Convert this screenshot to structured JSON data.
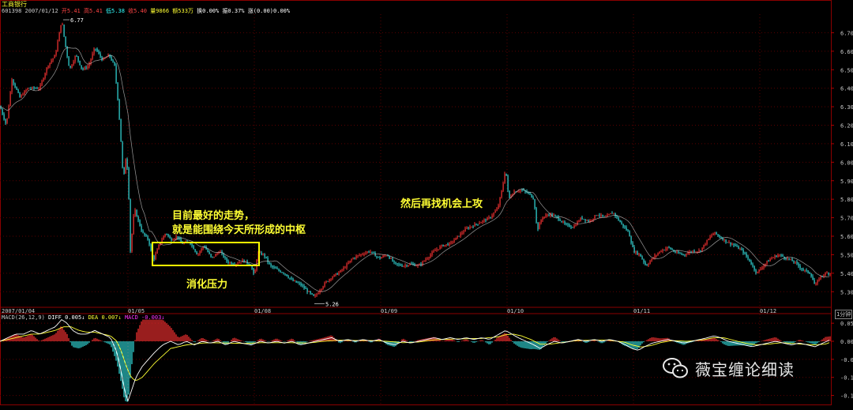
{
  "stock": {
    "name": "工商银行",
    "code": "601398",
    "date": "2007/01/12"
  },
  "header_line": [
    {
      "text": "开5.41",
      "color": "#ff4444"
    },
    {
      "text": "高5.41",
      "color": "#ff4444"
    },
    {
      "text": "低5.38",
      "color": "#33ffff"
    },
    {
      "text": "收5.40",
      "color": "#ff4444"
    },
    {
      "text": "量9866",
      "color": "#ffff33"
    },
    {
      "text": "额533万",
      "color": "#ffff33"
    },
    {
      "text": "换0.00%",
      "color": "#ffffff"
    },
    {
      "text": "振0.37%",
      "color": "#ffffff"
    },
    {
      "text": "涨(0.00)0.00%",
      "color": "#ffffff"
    }
  ],
  "macd_line": [
    {
      "text": "MACD(26,12,9)",
      "color": "#cccccc"
    },
    {
      "text": "DIFF 0.005↓",
      "color": "#ffffff"
    },
    {
      "text": "DEA 0.007↓",
      "color": "#ffff33"
    },
    {
      "text": "MACD -0.003↓",
      "color": "#ff33ff"
    }
  ],
  "annotations": {
    "line1": "目前最好的走势，",
    "line2": "就是能围绕今天所形成的中枢",
    "pressure": "消化压力",
    "next": "然后再找机会上攻"
  },
  "watermark": "薇宝缠论细读",
  "period": "1分钟",
  "price_marks": {
    "high": "6.77",
    "low": "5.26"
  },
  "chart_data": [
    {
      "type": "candlestick",
      "title": "工商银行",
      "y_ticks": [
        "6.70",
        "6.60",
        "6.50",
        "6.40",
        "6.30",
        "6.20",
        "6.10",
        "6.00",
        "5.90",
        "5.80",
        "5.70",
        "5.60",
        "5.50",
        "5.40",
        "5.30"
      ],
      "ylim": [
        5.22,
        6.8
      ],
      "x_ticks": [
        "2007/01/04",
        "01/05",
        "01/08",
        "01/09",
        "01/10",
        "01/11",
        "01/12"
      ],
      "grid": true,
      "path": [
        [
          0,
          6.3
        ],
        [
          8,
          6.2
        ],
        [
          15,
          6.45
        ],
        [
          25,
          6.35
        ],
        [
          35,
          6.4
        ],
        [
          50,
          6.4
        ],
        [
          60,
          6.52
        ],
        [
          70,
          6.58
        ],
        [
          78,
          6.77
        ],
        [
          82,
          6.65
        ],
        [
          88,
          6.5
        ],
        [
          96,
          6.58
        ],
        [
          104,
          6.5
        ],
        [
          112,
          6.52
        ],
        [
          120,
          6.62
        ],
        [
          130,
          6.55
        ],
        [
          138,
          6.58
        ],
        [
          145,
          6.52
        ],
        [
          150,
          6.3
        ],
        [
          154,
          6.05
        ],
        [
          156,
          5.89
        ],
        [
          159,
          6.02
        ],
        [
          162,
          5.95
        ],
        [
          165,
          5.52
        ],
        [
          170,
          5.75
        ],
        [
          180,
          5.62
        ],
        [
          188,
          5.58
        ],
        [
          192,
          5.5
        ],
        [
          195,
          5.48
        ],
        [
          202,
          5.56
        ],
        [
          210,
          5.62
        ],
        [
          216,
          5.58
        ],
        [
          224,
          5.6
        ],
        [
          230,
          5.56
        ],
        [
          240,
          5.57
        ],
        [
          250,
          5.5
        ],
        [
          258,
          5.55
        ],
        [
          268,
          5.48
        ],
        [
          278,
          5.52
        ],
        [
          288,
          5.46
        ],
        [
          298,
          5.45
        ],
        [
          308,
          5.47
        ],
        [
          318,
          5.44
        ],
        [
          322,
          5.38
        ],
        [
          326,
          5.51
        ],
        [
          334,
          5.5
        ],
        [
          342,
          5.44
        ],
        [
          350,
          5.42
        ],
        [
          360,
          5.4
        ],
        [
          370,
          5.36
        ],
        [
          380,
          5.34
        ],
        [
          390,
          5.3
        ],
        [
          398,
          5.27
        ],
        [
          405,
          5.31
        ],
        [
          412,
          5.35
        ],
        [
          420,
          5.38
        ],
        [
          428,
          5.4
        ],
        [
          436,
          5.43
        ],
        [
          446,
          5.48
        ],
        [
          456,
          5.5
        ],
        [
          468,
          5.52
        ],
        [
          480,
          5.48
        ],
        [
          490,
          5.5
        ],
        [
          500,
          5.45
        ],
        [
          510,
          5.44
        ],
        [
          520,
          5.45
        ],
        [
          530,
          5.44
        ],
        [
          540,
          5.48
        ],
        [
          550,
          5.52
        ],
        [
          560,
          5.55
        ],
        [
          570,
          5.56
        ],
        [
          580,
          5.6
        ],
        [
          590,
          5.64
        ],
        [
          600,
          5.66
        ],
        [
          610,
          5.68
        ],
        [
          620,
          5.7
        ],
        [
          630,
          5.75
        ],
        [
          636,
          5.86
        ],
        [
          640,
          5.97
        ],
        [
          644,
          5.8
        ],
        [
          650,
          5.84
        ],
        [
          660,
          5.85
        ],
        [
          670,
          5.83
        ],
        [
          676,
          5.8
        ],
        [
          680,
          5.63
        ],
        [
          686,
          5.7
        ],
        [
          696,
          5.72
        ],
        [
          706,
          5.7
        ],
        [
          716,
          5.66
        ],
        [
          726,
          5.65
        ],
        [
          736,
          5.7
        ],
        [
          746,
          5.68
        ],
        [
          756,
          5.72
        ],
        [
          766,
          5.7
        ],
        [
          776,
          5.73
        ],
        [
          786,
          5.67
        ],
        [
          796,
          5.62
        ],
        [
          802,
          5.52
        ],
        [
          810,
          5.5
        ],
        [
          818,
          5.44
        ],
        [
          826,
          5.48
        ],
        [
          836,
          5.52
        ],
        [
          846,
          5.54
        ],
        [
          856,
          5.51
        ],
        [
          866,
          5.5
        ],
        [
          876,
          5.52
        ],
        [
          886,
          5.52
        ],
        [
          896,
          5.58
        ],
        [
          904,
          5.62
        ],
        [
          910,
          5.6
        ],
        [
          920,
          5.57
        ],
        [
          930,
          5.55
        ],
        [
          940,
          5.52
        ],
        [
          950,
          5.46
        ],
        [
          958,
          5.4
        ],
        [
          966,
          5.44
        ],
        [
          976,
          5.48
        ],
        [
          986,
          5.5
        ],
        [
          996,
          5.48
        ],
        [
          1006,
          5.46
        ],
        [
          1016,
          5.42
        ],
        [
          1026,
          5.4
        ],
        [
          1032,
          5.33
        ],
        [
          1038,
          5.38
        ],
        [
          1046,
          5.4
        ],
        [
          1052,
          5.4
        ]
      ]
    },
    {
      "type": "bar",
      "title": "MACD(26,12,9)",
      "y_ticks": [
        "0.05",
        "0.00",
        "-0.05",
        "-0.10",
        "-0.15"
      ],
      "ylim": [
        -0.175,
        0.07
      ],
      "series": [
        {
          "name": "DIFF",
          "color": "#ffffff"
        },
        {
          "name": "DEA",
          "color": "#ffff33"
        },
        {
          "name": "MACD",
          "color": "#ff33ff"
        }
      ],
      "diff_path": [
        [
          0,
          0.0
        ],
        [
          10,
          0.01
        ],
        [
          20,
          0.02
        ],
        [
          30,
          0.02
        ],
        [
          40,
          0.03
        ],
        [
          50,
          0.02
        ],
        [
          60,
          0.03
        ],
        [
          70,
          0.04
        ],
        [
          78,
          0.06
        ],
        [
          85,
          0.05
        ],
        [
          92,
          0.03
        ],
        [
          100,
          0.02
        ],
        [
          110,
          0.02
        ],
        [
          120,
          0.03
        ],
        [
          130,
          0.02
        ],
        [
          140,
          0.01
        ],
        [
          148,
          -0.03
        ],
        [
          154,
          -0.09
        ],
        [
          158,
          -0.14
        ],
        [
          162,
          -0.165
        ],
        [
          166,
          -0.14
        ],
        [
          172,
          -0.1
        ],
        [
          180,
          -0.07
        ],
        [
          188,
          -0.05
        ],
        [
          196,
          -0.03
        ],
        [
          206,
          -0.01
        ],
        [
          216,
          0.0
        ],
        [
          226,
          -0.01
        ],
        [
          236,
          0.0
        ],
        [
          246,
          -0.01
        ],
        [
          256,
          0.0
        ],
        [
          266,
          -0.005
        ],
        [
          276,
          0.0
        ],
        [
          286,
          -0.01
        ],
        [
          296,
          0.0
        ],
        [
          306,
          -0.005
        ],
        [
          318,
          -0.01
        ],
        [
          330,
          0.0
        ],
        [
          340,
          -0.005
        ],
        [
          350,
          0.0
        ],
        [
          360,
          -0.005
        ],
        [
          370,
          0.0
        ],
        [
          380,
          -0.01
        ],
        [
          390,
          -0.005
        ],
        [
          400,
          0.0
        ],
        [
          410,
          0.005
        ],
        [
          420,
          0.01
        ],
        [
          430,
          0.0
        ],
        [
          440,
          0.005
        ],
        [
          450,
          0.0
        ],
        [
          460,
          0.005
        ],
        [
          470,
          0.0
        ],
        [
          480,
          0.005
        ],
        [
          490,
          -0.005
        ],
        [
          500,
          -0.01
        ],
        [
          510,
          0.0
        ],
        [
          520,
          -0.005
        ],
        [
          530,
          0.0
        ],
        [
          540,
          0.005
        ],
        [
          550,
          0.01
        ],
        [
          560,
          0.005
        ],
        [
          570,
          0.01
        ],
        [
          580,
          0.005
        ],
        [
          590,
          0.01
        ],
        [
          600,
          0.005
        ],
        [
          610,
          0.01
        ],
        [
          620,
          0.005
        ],
        [
          632,
          0.02
        ],
        [
          640,
          0.03
        ],
        [
          648,
          0.02
        ],
        [
          656,
          0.01
        ],
        [
          666,
          0.0
        ],
        [
          676,
          -0.01
        ],
        [
          684,
          -0.02
        ],
        [
          692,
          -0.01
        ],
        [
          702,
          0.0
        ],
        [
          712,
          -0.005
        ],
        [
          722,
          0.0
        ],
        [
          732,
          0.005
        ],
        [
          742,
          0.0
        ],
        [
          752,
          0.005
        ],
        [
          762,
          0.0
        ],
        [
          772,
          0.005
        ],
        [
          782,
          0.0
        ],
        [
          792,
          -0.01
        ],
        [
          800,
          -0.02
        ],
        [
          808,
          -0.025
        ],
        [
          816,
          -0.015
        ],
        [
          826,
          -0.005
        ],
        [
          836,
          0.0
        ],
        [
          846,
          0.005
        ],
        [
          856,
          0.0
        ],
        [
          866,
          -0.005
        ],
        [
          876,
          0.0
        ],
        [
          886,
          0.005
        ],
        [
          896,
          0.01
        ],
        [
          904,
          0.015
        ],
        [
          912,
          0.01
        ],
        [
          922,
          0.0
        ],
        [
          932,
          -0.005
        ],
        [
          942,
          -0.01
        ],
        [
          952,
          -0.015
        ],
        [
          962,
          -0.01
        ],
        [
          972,
          -0.005
        ],
        [
          982,
          0.0
        ],
        [
          992,
          -0.005
        ],
        [
          1002,
          -0.01
        ],
        [
          1012,
          -0.005
        ],
        [
          1022,
          -0.01
        ],
        [
          1032,
          -0.015
        ],
        [
          1042,
          -0.005
        ],
        [
          1052,
          0.005
        ]
      ],
      "dea_path": [
        [
          0,
          0.0
        ],
        [
          10,
          0.005
        ],
        [
          20,
          0.01
        ],
        [
          30,
          0.015
        ],
        [
          40,
          0.02
        ],
        [
          50,
          0.02
        ],
        [
          60,
          0.025
        ],
        [
          70,
          0.03
        ],
        [
          80,
          0.04
        ],
        [
          90,
          0.04
        ],
        [
          100,
          0.03
        ],
        [
          110,
          0.025
        ],
        [
          120,
          0.025
        ],
        [
          130,
          0.02
        ],
        [
          140,
          0.015
        ],
        [
          148,
          0.0
        ],
        [
          154,
          -0.03
        ],
        [
          160,
          -0.07
        ],
        [
          166,
          -0.1
        ],
        [
          172,
          -0.11
        ],
        [
          180,
          -0.1
        ],
        [
          188,
          -0.08
        ],
        [
          196,
          -0.06
        ],
        [
          206,
          -0.04
        ],
        [
          216,
          -0.02
        ],
        [
          226,
          -0.015
        ],
        [
          236,
          -0.01
        ],
        [
          246,
          -0.008
        ],
        [
          256,
          -0.005
        ],
        [
          270,
          -0.004
        ],
        [
          290,
          -0.005
        ],
        [
          310,
          -0.006
        ],
        [
          330,
          -0.004
        ],
        [
          350,
          -0.004
        ],
        [
          370,
          -0.004
        ],
        [
          390,
          -0.005
        ],
        [
          410,
          0.0
        ],
        [
          430,
          0.003
        ],
        [
          450,
          0.002
        ],
        [
          470,
          0.002
        ],
        [
          490,
          0.0
        ],
        [
          510,
          -0.004
        ],
        [
          530,
          -0.002
        ],
        [
          550,
          0.004
        ],
        [
          570,
          0.006
        ],
        [
          590,
          0.007
        ],
        [
          610,
          0.008
        ],
        [
          630,
          0.012
        ],
        [
          640,
          0.018
        ],
        [
          650,
          0.02
        ],
        [
          660,
          0.015
        ],
        [
          672,
          0.005
        ],
        [
          684,
          -0.008
        ],
        [
          696,
          -0.008
        ],
        [
          710,
          -0.004
        ],
        [
          730,
          0.002
        ],
        [
          750,
          0.003
        ],
        [
          770,
          0.003
        ],
        [
          790,
          -0.002
        ],
        [
          800,
          -0.01
        ],
        [
          812,
          -0.016
        ],
        [
          824,
          -0.012
        ],
        [
          836,
          -0.004
        ],
        [
          850,
          0.002
        ],
        [
          870,
          0.0
        ],
        [
          890,
          0.004
        ],
        [
          904,
          0.01
        ],
        [
          916,
          0.01
        ],
        [
          930,
          0.002
        ],
        [
          945,
          -0.006
        ],
        [
          958,
          -0.01
        ],
        [
          972,
          -0.008
        ],
        [
          990,
          -0.004
        ],
        [
          1010,
          -0.007
        ],
        [
          1030,
          -0.01
        ],
        [
          1045,
          -0.008
        ],
        [
          1052,
          -0.002
        ]
      ]
    }
  ]
}
